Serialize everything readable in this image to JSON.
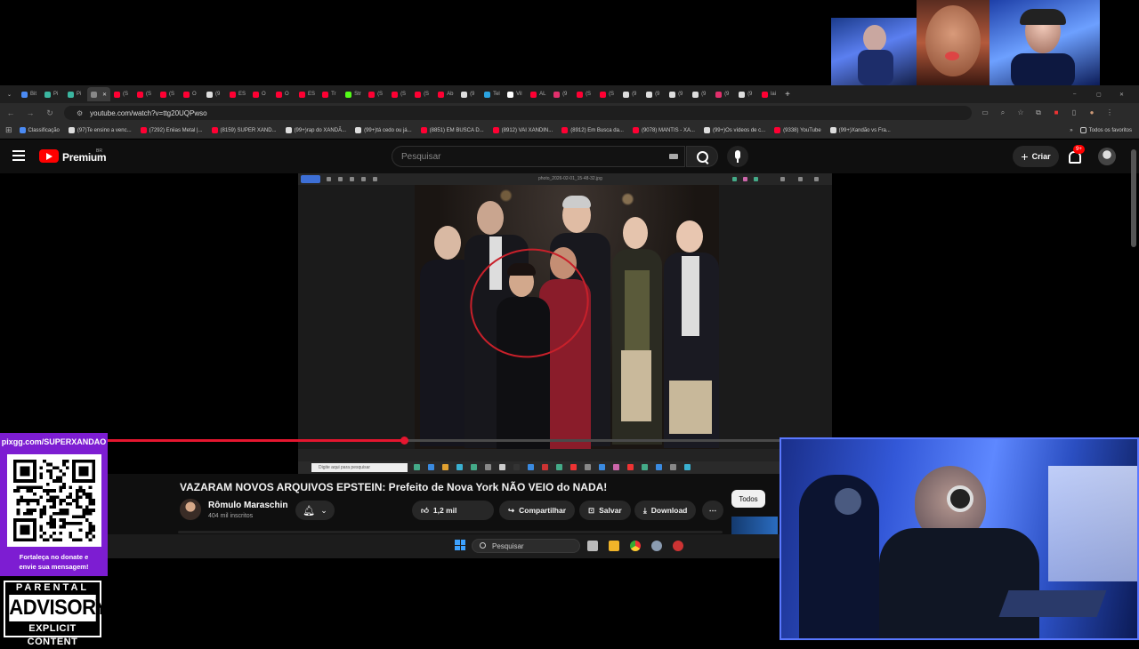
{
  "browser": {
    "tabs": [
      {
        "label": "Bit",
        "color": "#4b8bf5"
      },
      {
        "label": "Pi",
        "color": "#3bb6a0"
      },
      {
        "label": "Pi",
        "color": "#3bb6a0"
      },
      {
        "label": "",
        "color": "#888888",
        "active": true
      },
      {
        "label": "(S",
        "color": "#ff0033"
      },
      {
        "label": "(S",
        "color": "#ff0033"
      },
      {
        "label": "(S",
        "color": "#ff0033"
      },
      {
        "label": "O",
        "color": "#ff0033"
      },
      {
        "label": "(9",
        "color": "#dddddd"
      },
      {
        "label": "ES",
        "color": "#ff0033"
      },
      {
        "label": "O",
        "color": "#ff0033"
      },
      {
        "label": "O",
        "color": "#ff0033"
      },
      {
        "label": "ES",
        "color": "#ff0033"
      },
      {
        "label": "Tr",
        "color": "#ff0033"
      },
      {
        "label": "Str",
        "color": "#53fc18"
      },
      {
        "label": "(S",
        "color": "#ff0033"
      },
      {
        "label": "(S",
        "color": "#ff0033"
      },
      {
        "label": "(S",
        "color": "#ff0033"
      },
      {
        "label": "Ab",
        "color": "#ff0033"
      },
      {
        "label": "(9",
        "color": "#dddddd"
      },
      {
        "label": "Tel",
        "color": "#2aa3e0"
      },
      {
        "label": "Vil",
        "color": "#ffffff"
      },
      {
        "label": "AL",
        "color": "#ff0033"
      },
      {
        "label": "(9",
        "color": "#e1306c"
      },
      {
        "label": "(S",
        "color": "#ff0033"
      },
      {
        "label": "(S",
        "color": "#ff0033"
      },
      {
        "label": "(9",
        "color": "#dddddd"
      },
      {
        "label": "(9",
        "color": "#dddddd"
      },
      {
        "label": "(9",
        "color": "#dddddd"
      },
      {
        "label": "(9",
        "color": "#dddddd"
      },
      {
        "label": "(9",
        "color": "#e1306c"
      },
      {
        "label": "(9",
        "color": "#dddddd"
      },
      {
        "label": "lai",
        "color": "#ff0033"
      }
    ],
    "new_tab": "+",
    "url": "youtube.com/watch?v=ttg20UQPwso",
    "bookmarks": [
      {
        "label": "Classificação",
        "color": "#4b8bf5"
      },
      {
        "label": "(97)Te ensino a venc...",
        "color": "#dddddd"
      },
      {
        "label": "(7292) Eniias Metal |...",
        "color": "#ff0033"
      },
      {
        "label": "(8159) SUPER XAND...",
        "color": "#ff0033"
      },
      {
        "label": "(99+)rap do XANDÃ...",
        "color": "#dddddd"
      },
      {
        "label": "(99+)tá cedo ou já...",
        "color": "#dddddd"
      },
      {
        "label": "(8851) EM BUSCA D...",
        "color": "#ff0033"
      },
      {
        "label": "(8912) VAI XANDIN...",
        "color": "#ff0033"
      },
      {
        "label": "(8912) Em Busca da...",
        "color": "#ff0033"
      },
      {
        "label": "(9078) MANTIS - XA...",
        "color": "#ff0033"
      },
      {
        "label": "(99+)Os vídeos de c...",
        "color": "#dddddd"
      },
      {
        "label": "(9338) YouTube",
        "color": "#ff0033"
      },
      {
        "label": "(99+)Xandão vs Fra...",
        "color": "#dddddd"
      }
    ],
    "bookmarks_folder": "Todos os favoritos"
  },
  "youtube": {
    "brand": "Premium",
    "country": "BR",
    "search_placeholder": "Pesquisar",
    "create_label": "Criar",
    "notif_count": "9+",
    "video": {
      "viewer_title": "photo_2026-02-01_15-48-32.jpg",
      "inner_search": "Digite aqui para pesquisar",
      "progress_fraction": 0.44
    },
    "title": "VAZARAM NOVOS ARQUIVOS EPSTEIN: Prefeito de Nova York NÃO VEIO do NADA!",
    "channel": "Rômulo Maraschin",
    "subscribers": "404 mil inscritos",
    "likes": "1,2 mil",
    "share_label": "Compartilhar",
    "save_label": "Salvar",
    "download_label": "Download",
    "chip_label": "Todos"
  },
  "taskbar": {
    "search_label": "Pesquisar"
  },
  "overlay": {
    "donate_url": "pixgg.com/SUPERXANDAO",
    "donate_msg_1": "Fortaleça no donate e",
    "donate_msg_2": "envie sua mensagem!",
    "advisory_top": "PARENTAL",
    "advisory_mid": "ADVISORY",
    "advisory_bot": "EXPLICIT CONTENT"
  },
  "colors": {
    "accent_red": "#e5162f",
    "panel_purple": "#7d1dd2",
    "webcam_blue": "#3358d8"
  }
}
